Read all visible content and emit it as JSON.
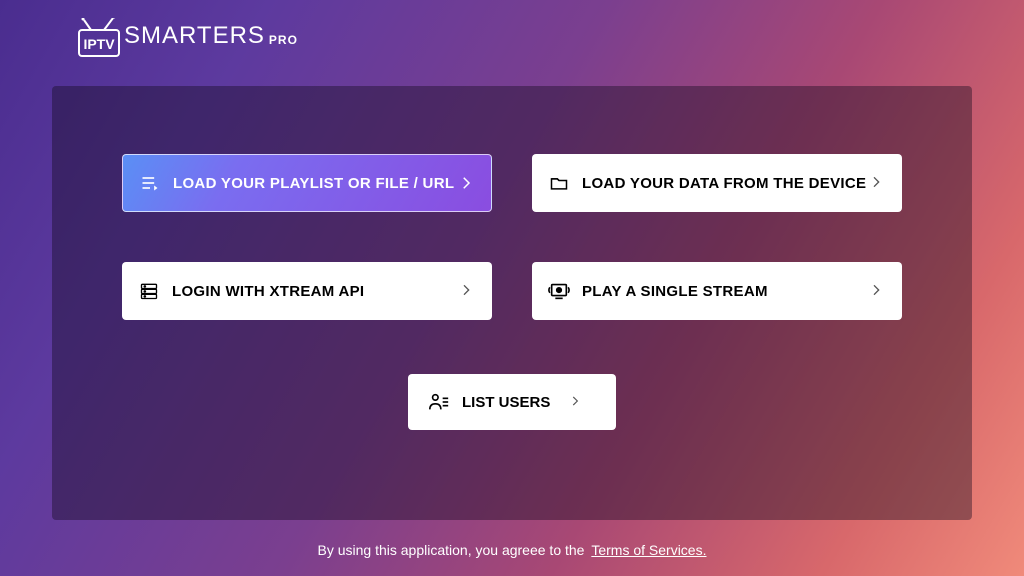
{
  "logo": {
    "iptv": "IPTV",
    "smarters": "SMARTERS",
    "pro": "PRO"
  },
  "options": {
    "load_playlist": "LOAD YOUR PLAYLIST OR FILE / URL",
    "load_device": "LOAD YOUR DATA FROM THE DEVICE",
    "xtream": "LOGIN WITH XTREAM API",
    "single_stream": "PLAY A SINGLE STREAM",
    "list_users": "LIST USERS"
  },
  "footer": {
    "text": "By using this application, you agreee to the",
    "link": "Terms of Services."
  }
}
